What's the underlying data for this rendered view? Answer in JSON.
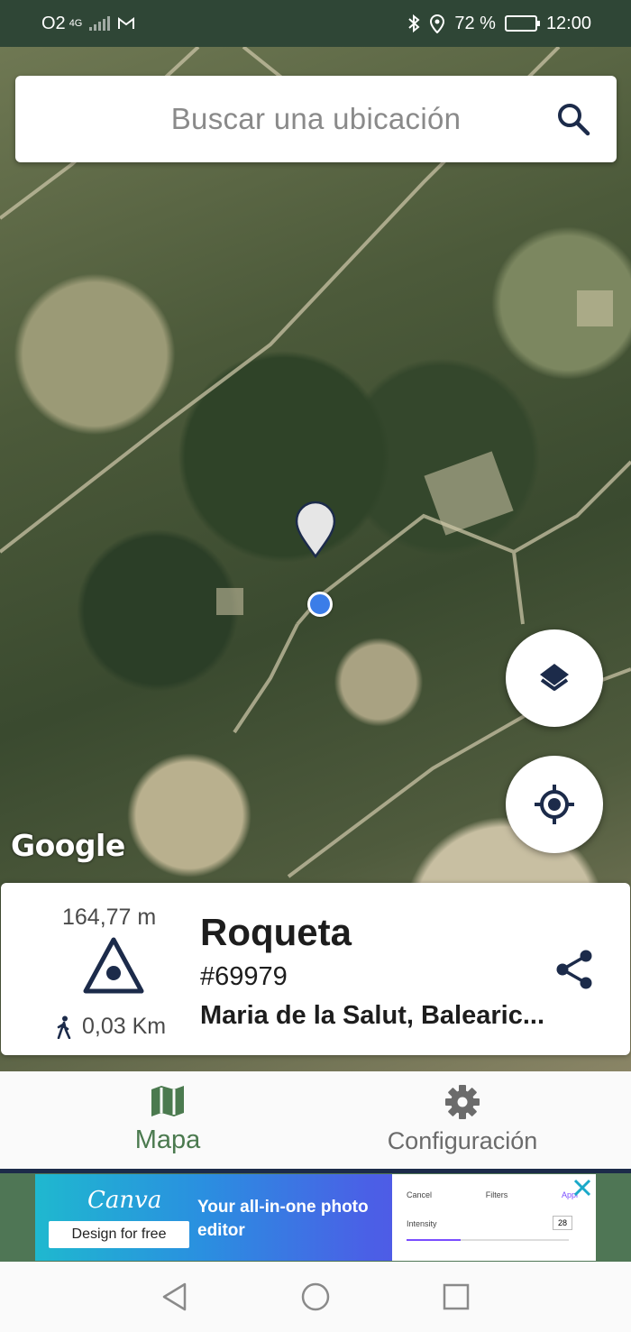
{
  "status_bar": {
    "carrier": "O2",
    "network_type": "4G",
    "battery_percent": "72 %",
    "time": "12:00"
  },
  "search": {
    "placeholder": "Buscar una ubicación"
  },
  "map": {
    "attribution": "Google"
  },
  "location_card": {
    "elevation": "164,77 m",
    "walking_distance": "0,03 Km",
    "name": "Roqueta",
    "id": "#69979",
    "region": "Maria de la Salut, Balearic..."
  },
  "bottom_nav": {
    "items": [
      {
        "label": "Mapa",
        "icon": "map-icon",
        "active": true
      },
      {
        "label": "Configuración",
        "icon": "gear-icon",
        "active": false
      }
    ]
  },
  "ad": {
    "brand": "Canva",
    "cta": "Design for free",
    "headline": "Your all-in-one photo editor",
    "preview": {
      "cancel": "Cancel",
      "filters": "Filters",
      "apply": "Appl",
      "intensity": "Intensity",
      "value": "28"
    }
  },
  "colors": {
    "accent_green": "#4b7a4f",
    "icon_navy": "#1c2b4a",
    "location_blue": "#3b7de8"
  }
}
